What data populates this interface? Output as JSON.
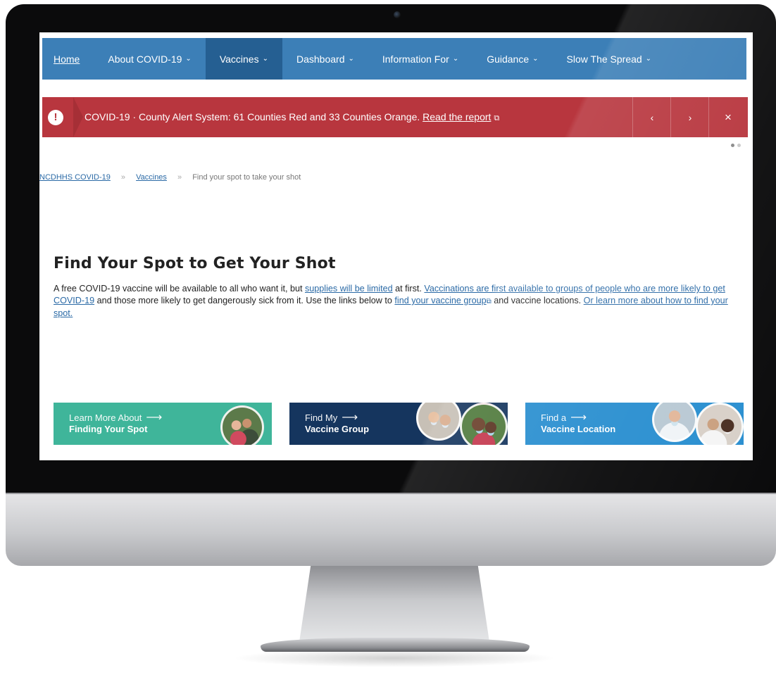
{
  "nav": {
    "items": [
      {
        "label": "Home"
      },
      {
        "label": "About COVID-19"
      },
      {
        "label": "Vaccines"
      },
      {
        "label": "Dashboard"
      },
      {
        "label": "Information For"
      },
      {
        "label": "Guidance"
      },
      {
        "label": "Slow The Spread"
      }
    ],
    "chevron": "⌄"
  },
  "alert": {
    "icon": "!",
    "text": "COVID-19 · County Alert System: 61 Counties Red and 33 Counties Orange.",
    "link": "Read the report",
    "external_icon": "⧉",
    "prev": "‹",
    "next": "›",
    "close": "×"
  },
  "breadcrumb": {
    "items": [
      "NCDHHS COVID-19",
      "Vaccines",
      "Find your spot to take your shot"
    ],
    "separator": "»"
  },
  "main": {
    "title": "Find Your Spot to Get Your Shot",
    "intro": {
      "t1": "A free COVID-19 vaccine will be available to all who want it, but ",
      "l1": "supplies will be limited",
      "t2": " at first. ",
      "l2": "Vaccinations are first available to groups of people who are more likely to get COVID-19",
      "t3": " and those more likely to get dangerously sick from it. Use the links below to ",
      "l3": "find your vaccine group",
      "t4": " and vaccine locations. ",
      "l4": "Or learn more about how to find your spot."
    }
  },
  "cards": [
    {
      "line1": "Learn More About",
      "line2": "Finding Your Spot",
      "arrow": "⟶",
      "color": "#3fb59a"
    },
    {
      "line1": "Find My",
      "line2": "Vaccine Group",
      "arrow": "⟶",
      "color": "#15355e"
    },
    {
      "line1": "Find a",
      "line2": "Vaccine Location",
      "arrow": "⟶",
      "color": "#2a8fd0"
    }
  ],
  "colors": {
    "nav": "#3c7fb7",
    "nav_active": "#255f92",
    "alert": "#b8363e",
    "link": "#2b6aa6"
  }
}
